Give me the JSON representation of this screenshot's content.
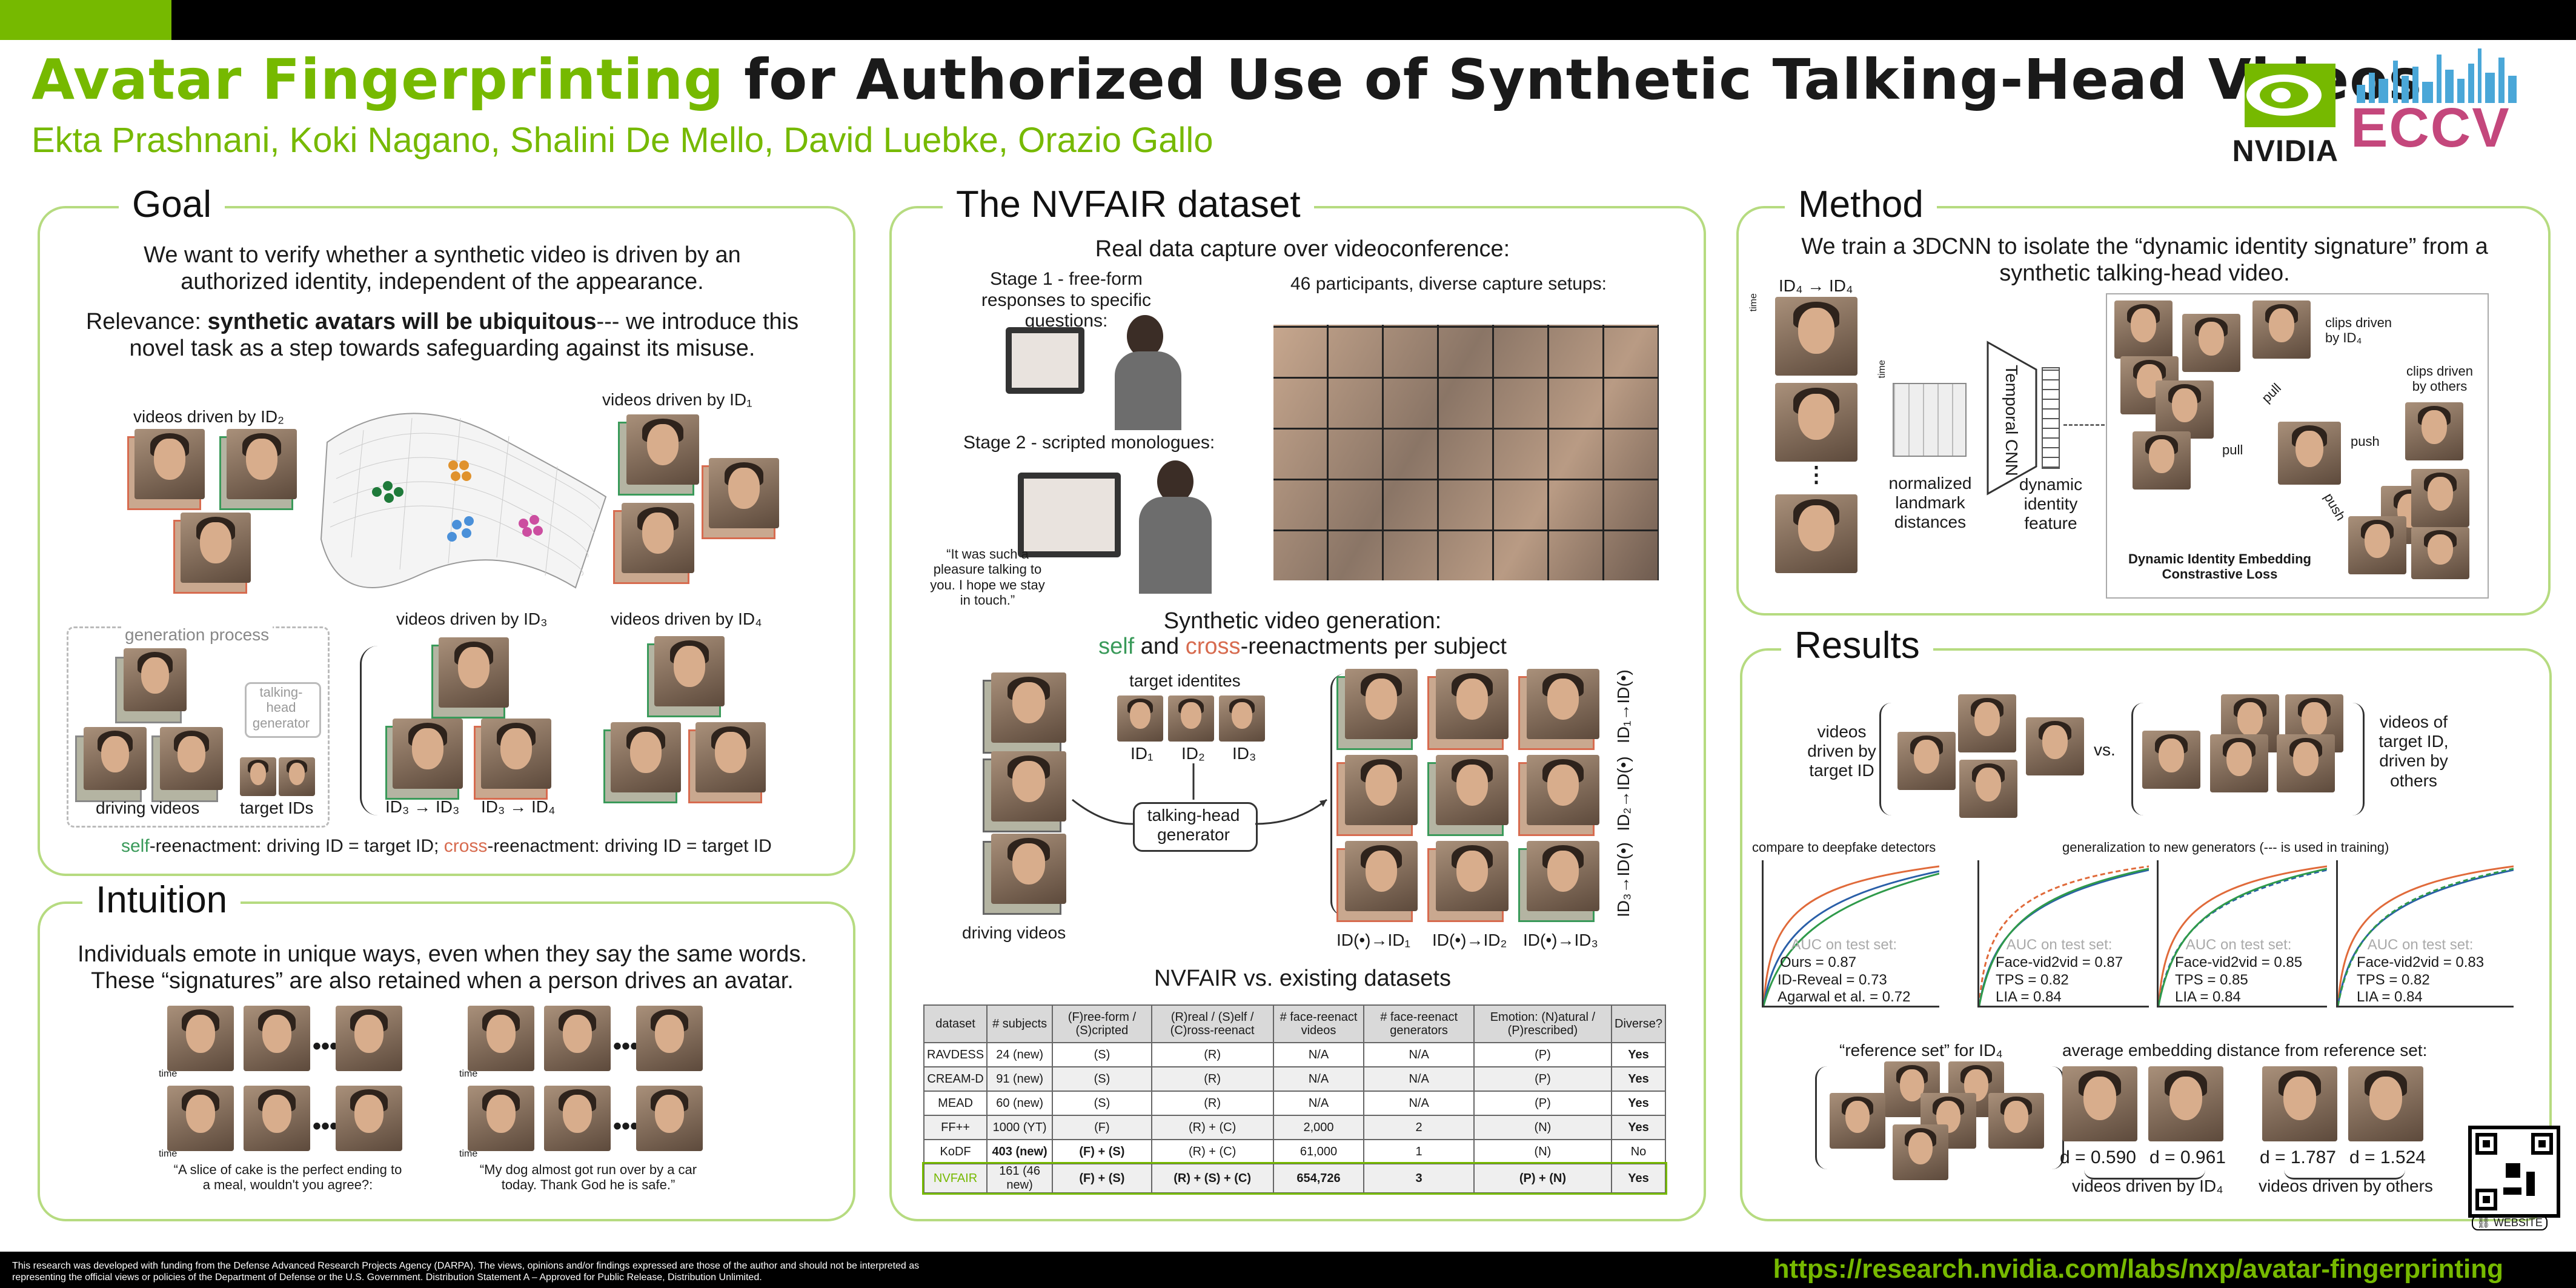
{
  "header": {
    "title_highlight": "Avatar Fingerprinting",
    "title_rest": " for Authorized Use of Synthetic Talking-Head Videos",
    "authors": "Ekta Prashnani, Koki Nagano, Shalini De Mello, David Luebke, Orazio Gallo",
    "logos": {
      "nvidia": "NVIDIA",
      "eccv": "ECCV"
    }
  },
  "goal": {
    "title": "Goal",
    "text1": "We want to verify whether a synthetic video is driven by an authorized identity, independent of the appearance.",
    "text2_prefix": "Relevance: ",
    "text2_bold": "synthetic avatars will be ubiquitous",
    "text2_rest": "--- we introduce this novel task as a step towards safeguarding against its misuse.",
    "labels": {
      "id2": "videos driven by ID₂",
      "id1": "videos driven by ID₁",
      "id3": "videos driven by ID₃",
      "id4": "videos driven by ID₄",
      "gen_process": "generation process",
      "generator": "talking-head generator",
      "driving": "driving videos",
      "target": "target IDs",
      "id3_3": "ID₃ → ID₃",
      "id3_4": "ID₃ → ID₄"
    },
    "caption_self": "self",
    "caption_mid": "-reenactment: driving ID = target ID; ",
    "caption_cross": "cross",
    "caption_end": "-reenactment: driving ID = target ID"
  },
  "intuition": {
    "title": "Intuition",
    "text": "Individuals emote in unique ways, even when they say the same words. These “signatures” are also retained when a person drives an avatar.",
    "time": "time",
    "quote1": "“A slice of cake is the perfect ending to a meal, wouldn't you agree?:",
    "quote2": "“My dog almost got run over by a car today. Thank God he is safe.”"
  },
  "dataset": {
    "title": "The NVFAIR dataset",
    "real": "Real data capture over videoconference:",
    "stage1": "Stage 1 - free-form responses to specific questions:",
    "participants": "46 participants, diverse capture setups:",
    "stage2": "Stage 2 - scripted monologues:",
    "quote": "“It was such a pleasure talking to you. I hope we stay in touch.”",
    "synth": "Synthetic video generation:",
    "synth_self": "self",
    "synth_and": " and ",
    "synth_cross": "cross",
    "synth_rest": "-reenactments per subject",
    "target_ids": "target identites",
    "ids": [
      "ID₁",
      "ID₂",
      "ID₃"
    ],
    "generator": "talking-head generator",
    "driving": "driving videos",
    "col_labels": [
      "ID(•)→ID₁",
      "ID(•)→ID₂",
      "ID(•)→ID₃"
    ],
    "row_labels": [
      "ID₁→ID(•)",
      "ID₂→ID(•)",
      "ID₃→ID(•)"
    ],
    "compare_title": "NVFAIR vs. existing datasets",
    "table": {
      "headers": [
        "dataset",
        "# subjects",
        "(F)ree-form / (S)cripted",
        "(R)real / (S)elf / (C)ross-reenact",
        "# face-reenact videos",
        "# face-reenact generators",
        "Emotion: (N)atural / (P)rescribed)",
        "Diverse?"
      ],
      "rows": [
        [
          "RAVDESS",
          "24 (new)",
          "(S)",
          "(R)",
          "N/A",
          "N/A",
          "(P)",
          "Yes"
        ],
        [
          "CREAM-D",
          "91 (new)",
          "(S)",
          "(R)",
          "N/A",
          "N/A",
          "(P)",
          "Yes"
        ],
        [
          "MEAD",
          "60 (new)",
          "(S)",
          "(R)",
          "N/A",
          "N/A",
          "(P)",
          "Yes"
        ],
        [
          "FF++",
          "1000 (YT)",
          "(F)",
          "(R) + (C)",
          "2,000",
          "2",
          "(N)",
          "Yes"
        ],
        [
          "KoDF",
          "403 (new)",
          "(F) + (S)",
          "(R) + (C)",
          "61,000",
          "1",
          "(N)",
          "No"
        ],
        [
          "NVFAIR",
          "161 (46 new)",
          "(F) + (S)",
          "(R) + (S) + (C)",
          "654,726",
          "3",
          "(P) + (N)",
          "Yes"
        ]
      ]
    }
  },
  "method": {
    "title": "Method",
    "text": "We train a 3DCNN to isolate the “dynamic identity signature” from a synthetic talking-head video.",
    "id44": "ID₄ → ID₄",
    "time": "time",
    "landmark": "normalized landmark distances",
    "cnn": "Temporal CNN",
    "feature": "dynamic identity feature",
    "clips_id4": "clips driven by ID₄",
    "clips_others": "clips driven by others",
    "pull": "pull",
    "push": "push",
    "loss": "Dynamic Identity Embedding Constrastive Loss"
  },
  "results": {
    "title": "Results",
    "driven_target": "videos driven by target ID",
    "vs": "vs.",
    "videos_target": "videos of target ID, driven by others",
    "compare_label": "compare to deepfake detectors",
    "general_label": "generalization to new generators (--- is used in training)",
    "auc_title": "AUC on test set:",
    "graph1": [
      "Ours = 0.87",
      "ID-Reveal = 0.73",
      "Agarwal et al. = 0.72"
    ],
    "graph2": [
      "Face-vid2vid = 0.87",
      "TPS = 0.82",
      "LIA = 0.84"
    ],
    "graph3": [
      "Face-vid2vid = 0.85",
      "TPS = 0.85",
      "LIA = 0.84"
    ],
    "graph4": [
      "Face-vid2vid = 0.83",
      "TPS = 0.82",
      "LIA = 0.84"
    ],
    "ref_set": "“reference set” for ID₄",
    "avg_dist": "average embedding distance from reference set:",
    "distances": [
      "d = 0.590",
      "d = 0.961",
      "d = 1.787",
      "d = 1.524"
    ],
    "driven_id4": "videos driven by ID₄",
    "driven_others": "videos driven by others",
    "website": "WEBSITE"
  },
  "footer": {
    "note": "This research was developed with funding from the Defense Advanced Research Projects Agency (DARPA). The views, opinions and/or findings expressed are those of the author and should not be interpreted as representing the official views or policies of the Department of Defense or the U.S. Government. Distribution Statement A – Approved for Public Release, Distribution Unlimited.",
    "url": "https://research.nvidia.com/labs/nxp/avatar-fingerprinting"
  },
  "colors": {
    "accent": "#76b900",
    "self": "#3a9a5a",
    "cross": "#d76b4f",
    "panel_border": "#b6db80"
  }
}
